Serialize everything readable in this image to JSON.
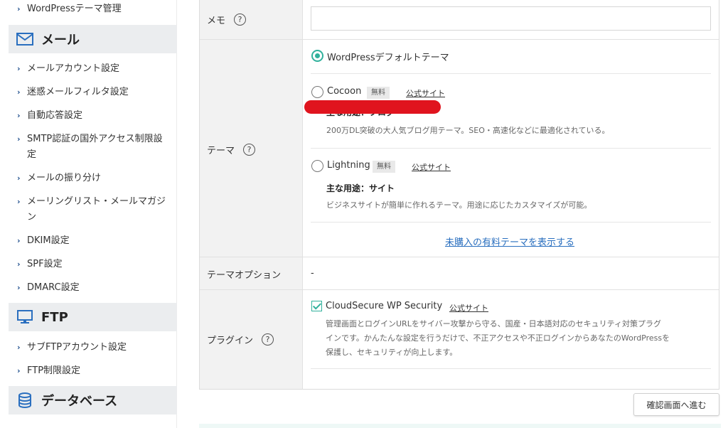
{
  "sidebar": {
    "top_item": "WordPressテーマ管理",
    "mail": {
      "title": "メール",
      "icon": "mail-icon",
      "items": [
        "メールアカウント設定",
        "迷惑メールフィルタ設定",
        "自動応答設定",
        "SMTP認証の国外アクセス制限設定",
        "メールの振り分け",
        "メーリングリスト・メールマガジン",
        "DKIM設定",
        "SPF設定",
        "DMARC設定"
      ]
    },
    "ftp": {
      "title": "FTP",
      "icon": "monitor-icon",
      "items": [
        "サブFTPアカウント設定",
        "FTP制限設定"
      ]
    },
    "database": {
      "title": "データベース",
      "icon": "database-icon"
    },
    "chevron_icon": "chevron-right-icon"
  },
  "form": {
    "memo": {
      "label": "メモ",
      "value": ""
    },
    "theme": {
      "label": "テーマ",
      "options": [
        {
          "name": "WordPressデフォルトテーマ",
          "selected": true
        },
        {
          "name": "Cocoon",
          "badge": "無料",
          "link": "公式サイト",
          "usage": "主な用途：ブログ",
          "desc": "200万DL突破の大人気ブログ用テーマ。SEO・高速化などに最適化されている。",
          "selected": false
        },
        {
          "name": "Lightning",
          "badge": "無料",
          "link": "公式サイト",
          "usage": "主な用途：サイト",
          "desc": "ビジネスサイトが簡単に作れるテーマ。用途に応じたカスタマイズが可能。",
          "selected": false
        }
      ],
      "show_paid_link": "未購入の有料テーマを表示する"
    },
    "theme_option": {
      "label": "テーマオプション",
      "value": "-"
    },
    "plugin": {
      "label": "プラグイン",
      "name": "CloudSecure WP Security",
      "link": "公式サイト",
      "checked": true,
      "desc": [
        "管理画面とログインURLをサイバー攻撃から守る、国産・日本語対応のセキュリティ対策プラグ",
        "インです。かんたんな設定を行うだけで、不正アクセスや不正ログインからあなたのWordPressを",
        "保護し、セキュリティが向上します。"
      ]
    },
    "help_glyph": "?"
  },
  "confirm_button": "確認画面へ進む",
  "colors": {
    "accent": "#31b19c",
    "link": "#2a6fbf",
    "nav_chevron": "#1d4d8c",
    "redaction": "#e0141e"
  }
}
